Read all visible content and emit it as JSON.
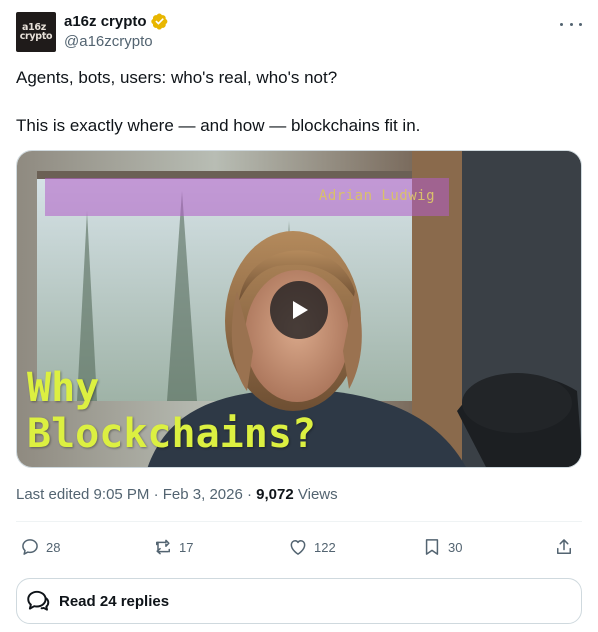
{
  "author": {
    "avatar_line1": "a16z",
    "avatar_line2": "crypto",
    "display_name": "a16z crypto",
    "handle": "@a16zcrypto",
    "verified_badge_color": "#e8b600",
    "more_icon": "ellipsis-icon"
  },
  "tweet": {
    "line1": "Agents, bots, users: who's real, who's not?",
    "line2": "This is exactly where — and how — blockchains fit in."
  },
  "media": {
    "type": "video",
    "name_tag": "Adrian Ludwig",
    "caption_line1": "Why",
    "caption_line2": "Blockchains?",
    "caption_color": "#dcf041",
    "play_icon": "play-icon"
  },
  "meta": {
    "edited_label": "Last edited 9:05 PM",
    "separator": "·",
    "date": "Feb 3, 2026",
    "views_count": "9,072",
    "views_label": "Views"
  },
  "actions": {
    "replies": "28",
    "reposts": "17",
    "likes": "122",
    "bookmarks": "30"
  },
  "read_replies": {
    "label": "Read 24 replies"
  }
}
